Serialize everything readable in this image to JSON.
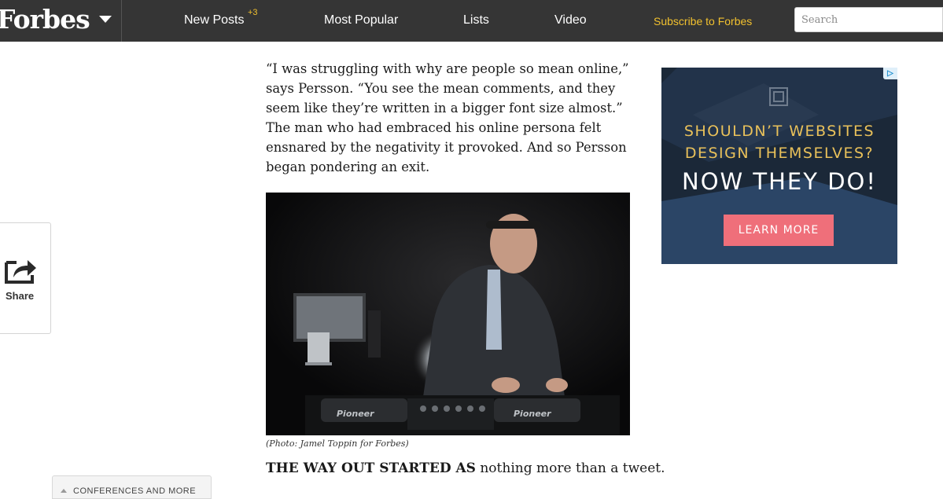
{
  "header": {
    "logo": "Forbes",
    "nav": [
      {
        "label": "New Posts",
        "badge": "+3"
      },
      {
        "label": "Most Popular"
      },
      {
        "label": "Lists"
      },
      {
        "label": "Video"
      }
    ],
    "subscribe": "Subscribe to Forbes",
    "search_placeholder": "Search"
  },
  "share": {
    "label": "Share",
    "icon": "share-arrow-icon"
  },
  "article": {
    "paragraph": "“I was struggling with why are people so mean online,” says Persson. “You see the mean comments, and they seem like they’re written in a bigger font size almost.” The man who had embraced his online persona felt ensnared by the negativity it provoked. And so Persson began pondering an exit.",
    "photo_caption": "(Photo: Jamel Toppin for Forbes)",
    "photo_brand_left": "Pioneer",
    "photo_brand_right": "Pioneer",
    "lead_strong": "THE WAY OUT STARTED AS",
    "lead_rest": " nothing more than a tweet."
  },
  "ad": {
    "line1": "SHOULDN’T WEBSITES",
    "line2": "DESIGN THEMSELVES?",
    "line3": "NOW THEY DO!",
    "button": "LEARN MORE",
    "choices_icon": "adchoices-icon",
    "colors": {
      "bg": "#1b2838",
      "accent": "#e9c15a",
      "button": "#ef6f7a"
    }
  },
  "footer_panel": {
    "label": "CONFERENCES AND MORE"
  }
}
